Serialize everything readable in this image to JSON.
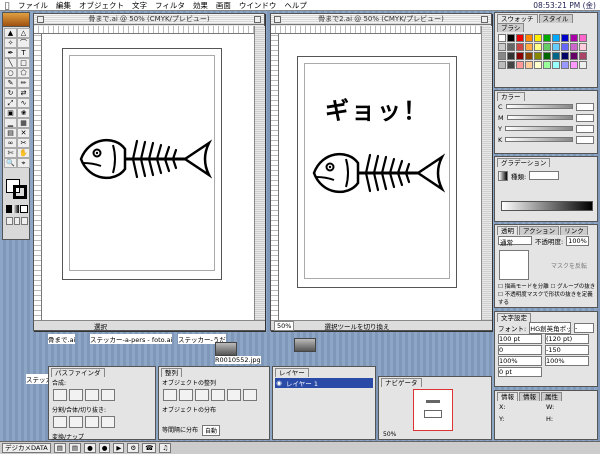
{
  "menubar": {
    "items": [
      "ファイル",
      "編集",
      "オブジェクト",
      "文字",
      "フィルタ",
      "効果",
      "画面",
      "ウインドウ",
      "ヘルプ"
    ],
    "clock": "08:53:21 PM (金)"
  },
  "doc1": {
    "title": "骨まで.ai @ 50% (CMYK/プレビュー)",
    "zoom": "",
    "status": "選択"
  },
  "doc2": {
    "title": "骨まで2.ai @ 50% (CMYK/プレビュー)",
    "zoom": "50%",
    "status": "選択ツールを切り換え",
    "headline": "ギョッ！"
  },
  "desktop_icons": [
    "骨まで.ai",
    "ステッカー-a-pers - foto.ai",
    "ステッカー-うだ",
    "R0010552.jpg",
    "ステッカー"
  ],
  "swatches": {
    "tabs": [
      "スウォッチ",
      "スタイル",
      "ブラシ"
    ]
  },
  "color": {
    "tab": "カラー",
    "channels": [
      "C",
      "M",
      "Y",
      "K"
    ]
  },
  "gradient": {
    "tab": "グラデーション",
    "type_label": "種類:",
    "type_value": "",
    "angle_label": "",
    "location_label": ""
  },
  "transparency": {
    "tabs": [
      "透明",
      "アクション",
      "リンク"
    ],
    "mode": "通常",
    "opacity_label": "不透明度:",
    "opacity_value": "100%",
    "mask_label": "マスクを反転",
    "options": [
      "描画モードを分離",
      "グループの抜き",
      "不透明度マスクで形状の抜きを定義する"
    ]
  },
  "character": {
    "tab": "文字設定",
    "font_label": "フォント:",
    "font_value": "HG創英角ポップ体",
    "style_value": "-",
    "size": "100 pt",
    "leading": "(120 pt)",
    "tracking": "0",
    "kerning": "-150",
    "hscale": "100%",
    "vscale": "100%",
    "baseline": "0 pt"
  },
  "info": {
    "tabs": [
      "情報",
      "情報",
      "属性"
    ],
    "x": "X:",
    "y": "Y:",
    "w": "W:",
    "h": "H:"
  },
  "pathfinder": {
    "tab": "パスファインダ",
    "shape_modes": "合成:",
    "pathfinders": "分割/合体/切り抜き:",
    "trap": "変換/ナップ"
  },
  "align": {
    "tab": "整列",
    "align_objects": "オブジェクトの整列",
    "distribute_objects": "オブジェクトの分布",
    "distribute_spacing": "等間隔に分布",
    "auto": "自動"
  },
  "layers": {
    "tab": "レイヤー",
    "layer_name": "レイヤー 1"
  },
  "navigator": {
    "tab": "ナビゲータ",
    "zoom": "50%"
  },
  "taskbar": {
    "items": [
      "デジカメDATA",
      "",
      "",
      "",
      "",
      "",
      "",
      "",
      ""
    ]
  }
}
